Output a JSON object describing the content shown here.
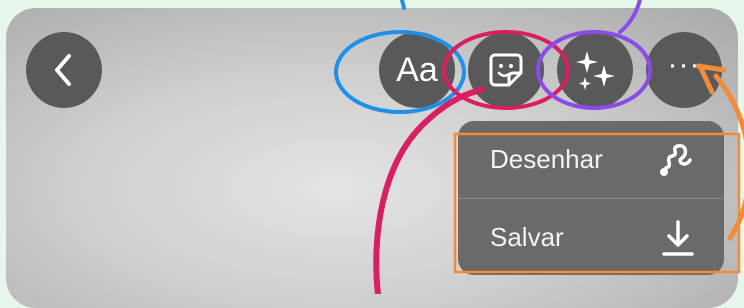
{
  "toolbar": {
    "back_icon": "chevron-left-icon",
    "text_label": "Aa",
    "sticker_icon": "sticker-icon",
    "effects_icon": "sparkles-icon",
    "more_icon": "ellipsis-icon"
  },
  "menu": {
    "items": [
      {
        "label": "Desenhar",
        "icon": "draw-squiggle-icon"
      },
      {
        "label": "Salvar",
        "icon": "download-icon"
      }
    ]
  },
  "colors": {
    "button_bg": "#595959",
    "menu_bg": "#6a6a6a",
    "annotation_blue": "#1e90e8",
    "annotation_magenta": "#d81f63",
    "annotation_purple": "#8a4be8",
    "annotation_orange": "#f28c38",
    "page_bg": "#e6f6ea"
  }
}
